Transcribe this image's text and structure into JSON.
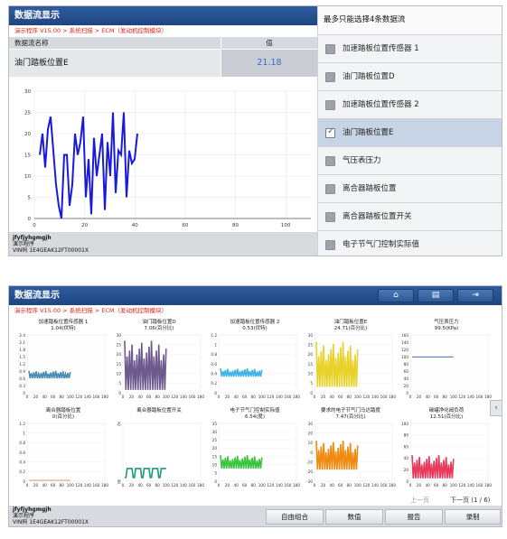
{
  "shot1": {
    "title": "数据流显示",
    "breadcrumb": "演示程序 V15.00 > 系统扫描 > ECM（发动机控制模块）",
    "grid": {
      "col_name": "数据流名称",
      "col_value": "值"
    },
    "selected_row": {
      "name": "油门踏板位置E",
      "value": "21.18"
    },
    "chart": {
      "y_ticks": [
        "30",
        "25",
        "20",
        "15",
        "10",
        "5",
        "0"
      ],
      "x_ticks": [
        "0",
        "20",
        "40",
        "60",
        "80",
        "100"
      ]
    },
    "footer": {
      "line1": "jfyfjyhgmgjh",
      "line2": "演示程序",
      "line3": "VIN码 1E4GEAK12FT00001X"
    },
    "selector": {
      "header": "最多只能选择4条数据流",
      "items": [
        {
          "label": "加速踏板位置传感器 1",
          "checked": false
        },
        {
          "label": "油门踏板位置D",
          "checked": false
        },
        {
          "label": "加速踏板位置传感器 2",
          "checked": false
        },
        {
          "label": "油门踏板位置E",
          "checked": true
        },
        {
          "label": "气压表压力",
          "checked": false
        },
        {
          "label": "离合器踏板位置",
          "checked": false
        },
        {
          "label": "离合器踏板位置开关",
          "checked": false
        },
        {
          "label": "电子节气门控制实际值",
          "checked": false
        }
      ]
    }
  },
  "shot2": {
    "title": "数据流显示",
    "breadcrumb": "演示程序 V15.00 > 系统扫描 > ECM（发动机控制模块）",
    "toolbar": {
      "home_icon": "home-icon",
      "print_icon": "print-icon",
      "exit_icon": "exit-icon"
    },
    "charts": [
      {
        "name": "加速踏板位置传感器 1",
        "value": "1.04(伏特)",
        "color": "#4a8fb3",
        "y": [
          "2.4",
          "2.1",
          "1.8",
          "1.5",
          "1.2",
          "0.9",
          "0.6",
          "0.3",
          "0"
        ],
        "x": [
          "0",
          "20",
          "40",
          "60",
          "80",
          "100",
          "120",
          "140",
          "160",
          "180"
        ]
      },
      {
        "name": "油门踏板位置D",
        "value": "7.06(百分比)",
        "color": "#6e5a8e",
        "y": [
          "30",
          "25",
          "20",
          "15",
          "10",
          "5",
          "0"
        ],
        "x": [
          "0",
          "20",
          "40",
          "60",
          "80",
          "100",
          "120",
          "140",
          "160",
          "180"
        ]
      },
      {
        "name": "加速踏板位置传感器 2",
        "value": "0.53(伏特)",
        "color": "#3fb2e8",
        "y": [
          "1.2",
          "1",
          "0.8",
          "0.6",
          "0.4",
          "0.2",
          "0"
        ],
        "x": [
          "0",
          "20",
          "40",
          "60",
          "80",
          "100",
          "120",
          "140",
          "160",
          "180"
        ]
      },
      {
        "name": "油门踏板位置E",
        "value": "24.71(百分比)",
        "color": "#e8d22a",
        "y": [
          "30",
          "25",
          "20",
          "15",
          "10",
          "5",
          "0"
        ],
        "x": [
          "0",
          "20",
          "40",
          "60",
          "80",
          "100",
          "120",
          "140",
          "160",
          "180"
        ]
      },
      {
        "name": "气压表压力",
        "value": "99.5(KPa)",
        "color": "#2a5fb0",
        "y": [
          "160",
          "140",
          "120",
          "100",
          "80",
          "60",
          "40",
          "20",
          "0"
        ],
        "x": [
          "0",
          "20",
          "40",
          "60",
          "80",
          "100",
          "120",
          "140",
          "160",
          "180"
        ]
      },
      {
        "name": "离合器踏板位置",
        "value": "0(百分比)",
        "color": "#e07a20",
        "y": [
          "1.2",
          "1",
          "0.8",
          "0.6",
          "0.4",
          "0.2",
          "0"
        ],
        "x": [
          "0",
          "20",
          "40",
          "60",
          "80",
          "100",
          "120",
          "140",
          "160",
          "180"
        ]
      },
      {
        "name": "离合器踏板位置开关",
        "value": "",
        "color": "#1a9a7a",
        "y": [
          "否",
          "是"
        ],
        "x": [
          "0",
          "20",
          "40",
          "60",
          "80",
          "100",
          "120",
          "140",
          "160",
          "180"
        ],
        "title_suffix": "否"
      },
      {
        "name": "电子节气门控制实际值",
        "value": "6.54(度)",
        "color": "#3cc43c",
        "y": [
          "35",
          "30",
          "25",
          "20",
          "15",
          "10",
          "5",
          "0"
        ],
        "x": [
          "0",
          "20",
          "40",
          "60",
          "80",
          "100",
          "120",
          "140",
          "160",
          "180"
        ]
      },
      {
        "name": "要求的电子节气门马达踏度",
        "value": "7.47(百分比)",
        "color": "#f08a10",
        "y": [
          "30",
          "20",
          "10",
          "0",
          "-10",
          "-20",
          "-30"
        ],
        "x": [
          "0",
          "20",
          "40",
          "60",
          "80",
          "100",
          "120",
          "140",
          "160",
          "180"
        ]
      },
      {
        "name": "碳罐净化阀负荷",
        "value": "12.51(百分比)",
        "color": "#e83a5a",
        "y": [
          "100",
          "80",
          "60",
          "40",
          "20",
          "0"
        ],
        "x": [
          "0",
          "20",
          "40",
          "60",
          "80",
          "100",
          "120",
          "140",
          "160",
          "180"
        ]
      }
    ],
    "pager": {
      "prev": "上一页",
      "next": "下一页",
      "page": "(1 / 6)"
    },
    "footer": {
      "line1": "jfyfjyhgmgjh",
      "line2": "演示程序",
      "line3": "VIN码 1E4GEAK12FT00001X"
    },
    "buttons": {
      "combine": "自由组合",
      "value": "数值",
      "report": "报告",
      "record": "录制"
    }
  }
}
